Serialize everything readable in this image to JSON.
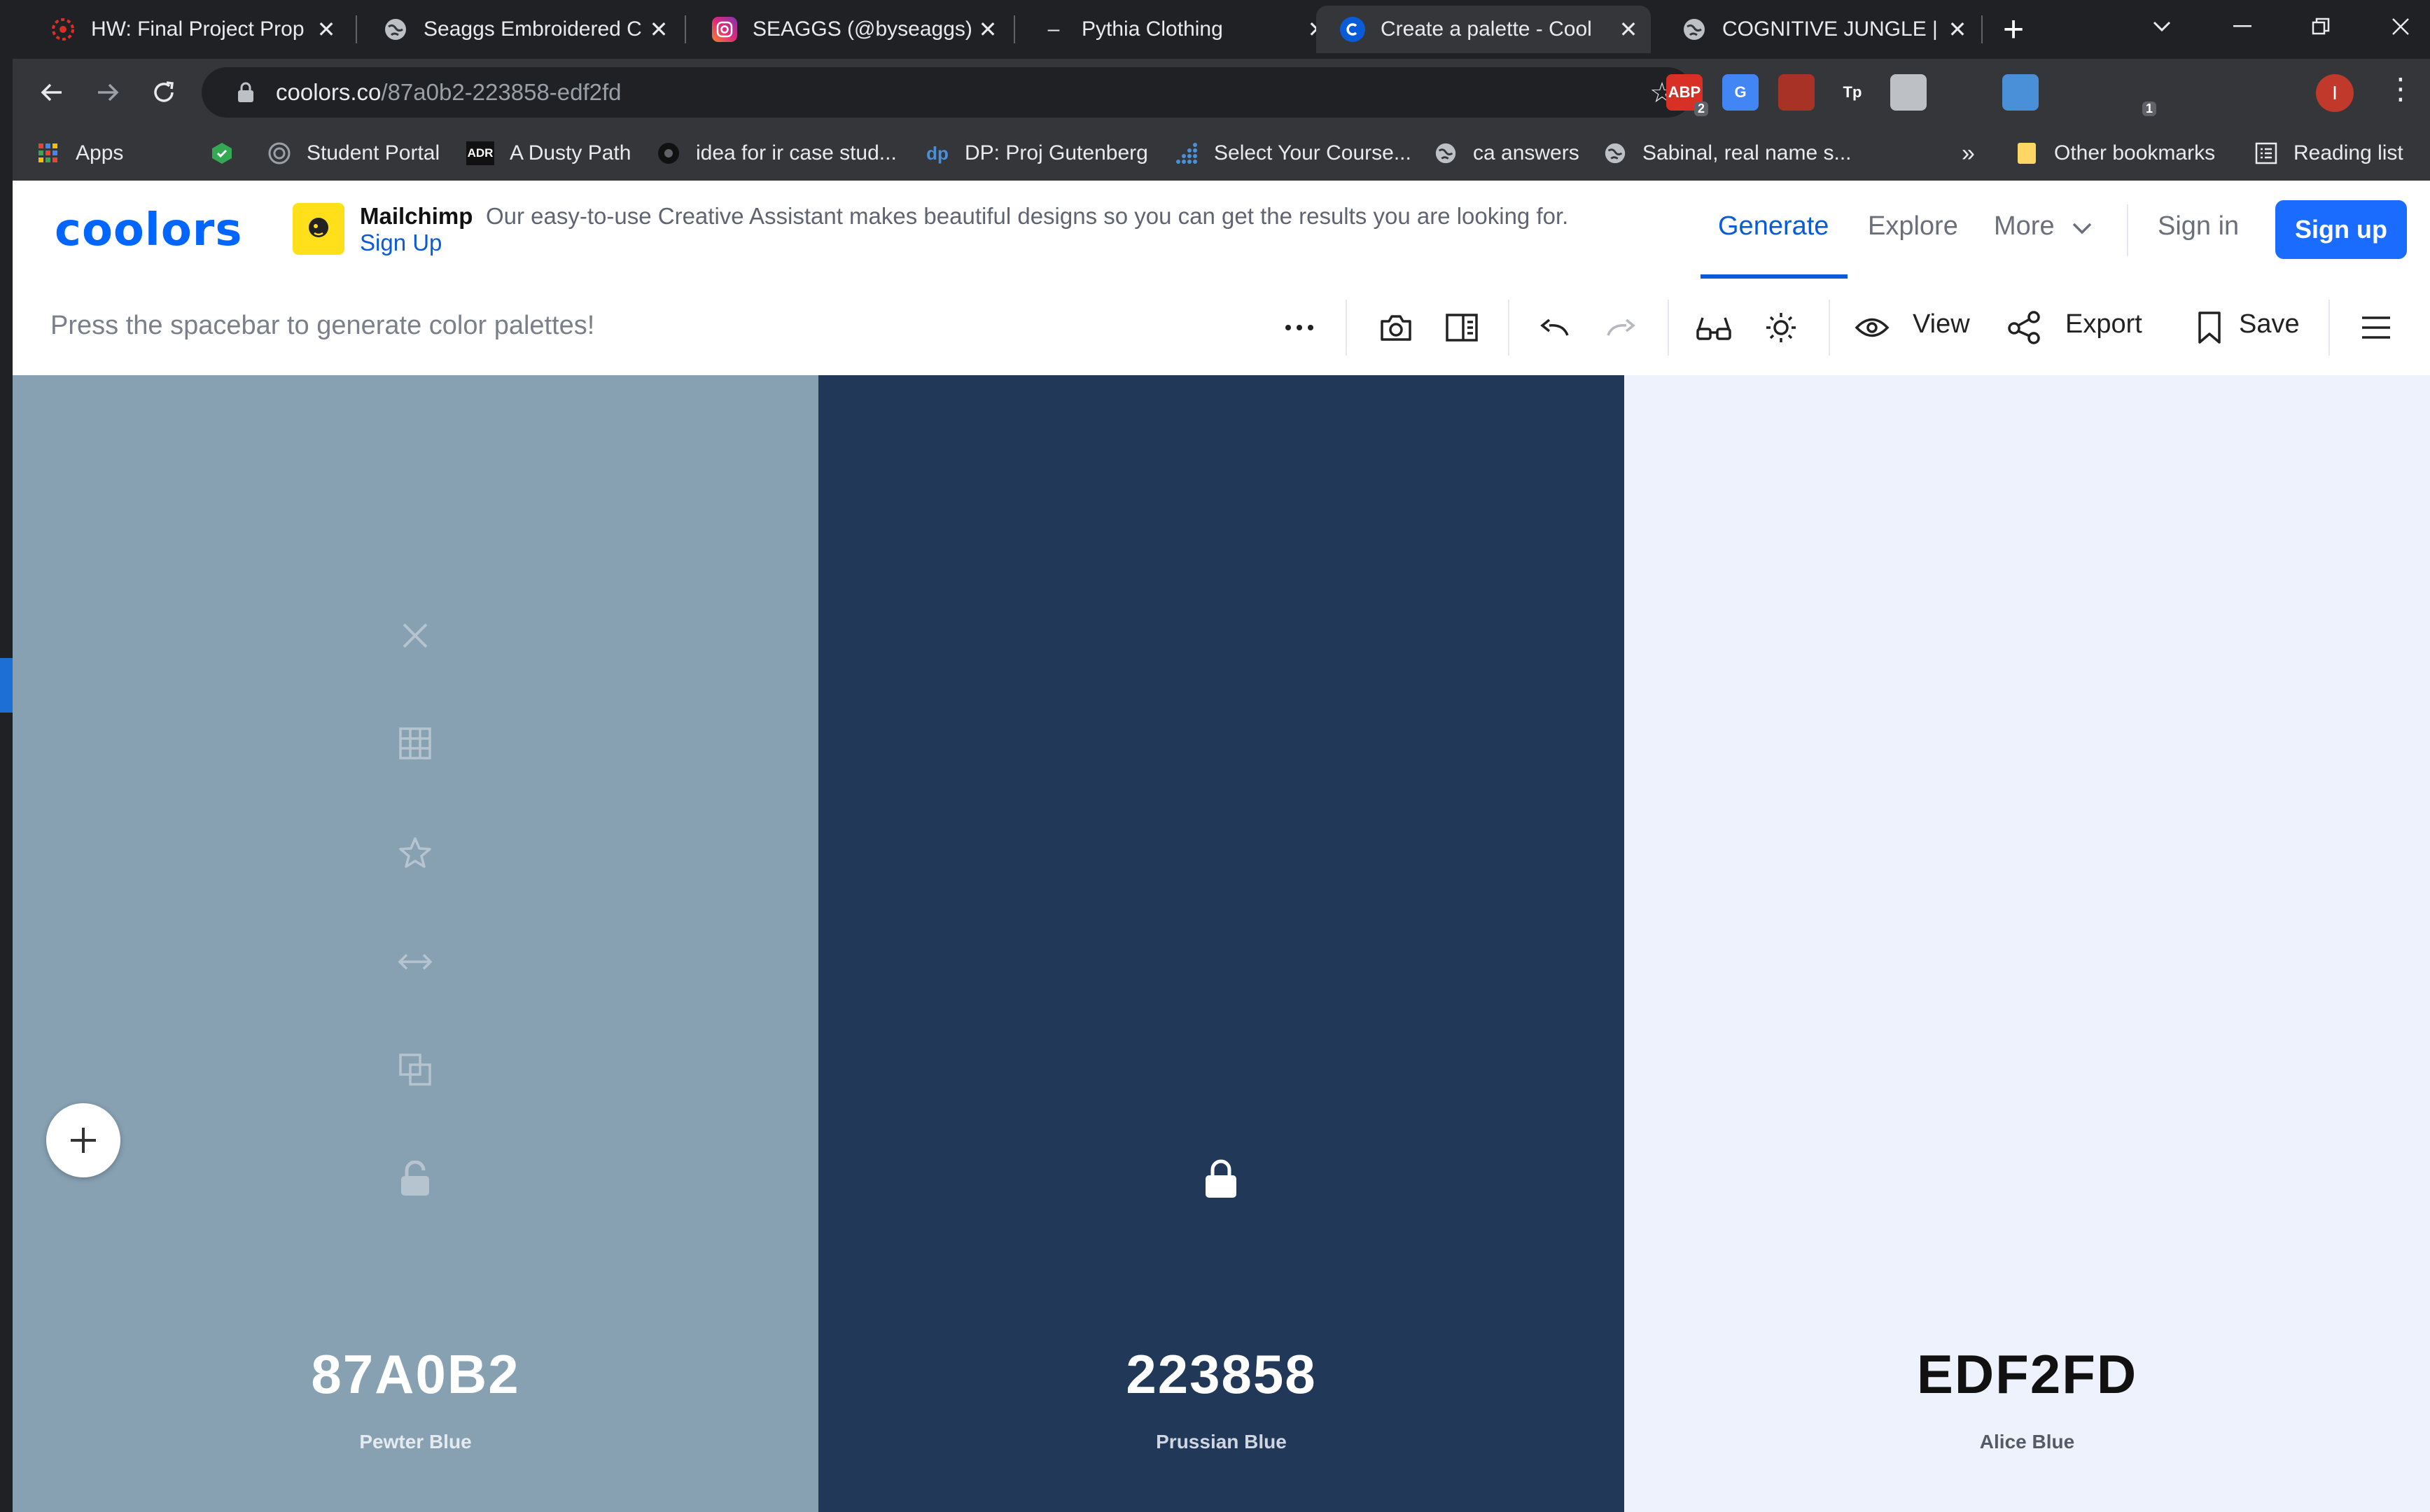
{
  "browser": {
    "tabs": [
      {
        "title": "HW: Final Project Prop",
        "favicon": "asu-sunburst-icon"
      },
      {
        "title": "Seaggs Embroidered C",
        "favicon": "globe-icon"
      },
      {
        "title": "SEAGGS (@byseaggs) ·",
        "favicon": "instagram-icon"
      },
      {
        "title": "Pythia Clothing",
        "favicon": "dash-icon"
      },
      {
        "title": "Create a palette - Cool",
        "favicon": "coolors-icon"
      },
      {
        "title": "COGNITIVE JUNGLE | L",
        "favicon": "globe-icon"
      }
    ],
    "url_host": "coolors.co",
    "url_path": "/87a0b2-223858-edf2fd",
    "profile_initial": "I",
    "extensions": [
      {
        "name": "adblock-icon",
        "badge": "2",
        "color": "#d93025",
        "text": "ABP"
      },
      {
        "name": "google-translate-icon",
        "badge": "",
        "color": "#4285f4",
        "text": "G"
      },
      {
        "name": "bookmark-red-icon",
        "badge": "",
        "color": "#a93226",
        "text": ""
      },
      {
        "name": "tp-icon",
        "badge": "",
        "color": "#35363a",
        "text": "Tp"
      },
      {
        "name": "circle-extension-icon",
        "badge": "",
        "color": "#bdc1c6",
        "text": ""
      },
      {
        "name": "pocket-icon",
        "badge": "",
        "color": "#35363a",
        "text": ""
      },
      {
        "name": "window-extension-icon",
        "badge": "",
        "color": "#4a90d9",
        "text": ""
      },
      {
        "name": "soundcloud-icon",
        "badge": "",
        "color": "#35363a",
        "text": ""
      },
      {
        "name": "hand-icon",
        "badge": "1",
        "color": "#35363a",
        "text": ""
      },
      {
        "name": "graduation-cap-icon",
        "badge": "",
        "color": "#35363a",
        "text": ""
      },
      {
        "name": "puzzle-icon",
        "badge": "",
        "color": "#35363a",
        "text": ""
      }
    ],
    "bookmarks": [
      {
        "label": "Apps",
        "icon": "apps-grid-icon"
      },
      {
        "label": "",
        "icon": "hexagon-bookmark-icon"
      },
      {
        "label": "Student Portal",
        "icon": "portal-icon"
      },
      {
        "label": "A Dusty Path",
        "icon": "adr-icon"
      },
      {
        "label": "idea for ir case stud...",
        "icon": "dark-circle-icon"
      },
      {
        "label": "DP: Proj Gutenberg",
        "icon": "dp-icon"
      },
      {
        "label": "Select Your Course...",
        "icon": "dots-chart-icon"
      },
      {
        "label": "ca answers",
        "icon": "globe-icon"
      },
      {
        "label": "Sabinal, real name s...",
        "icon": "globe-icon"
      }
    ],
    "bookmarks_overflow": "»",
    "other_bookmarks": "Other bookmarks",
    "reading_list": "Reading list"
  },
  "site": {
    "logo": "coolors",
    "ad": {
      "brand": "Mailchimp",
      "text": "Our easy-to-use Creative Assistant makes beautiful designs so you can get the results you are looking for.",
      "link": "Sign Up"
    },
    "nav": {
      "generate": "Generate",
      "explore": "Explore",
      "more": "More",
      "signin": "Sign in",
      "signup": "Sign up"
    },
    "toolbar": {
      "hint": "Press the spacebar to generate color palettes!",
      "view": "View",
      "export": "Export",
      "save": "Save"
    }
  },
  "palette": [
    {
      "hex": "87A0B2",
      "name": "Pewter Blue",
      "bg": "#87a0b2",
      "text_color": "#ffffff",
      "sub_color": "#e4eaf0",
      "locked": false
    },
    {
      "hex": "223858",
      "name": "Prussian Blue",
      "bg": "#223858",
      "text_color": "#ffffff",
      "sub_color": "#cfd6e2",
      "locked": true
    },
    {
      "hex": "EDF2FD",
      "name": "Alice Blue",
      "bg": "#edf2fd",
      "text_color": "#111111",
      "sub_color": "#555b66",
      "locked": false
    }
  ]
}
